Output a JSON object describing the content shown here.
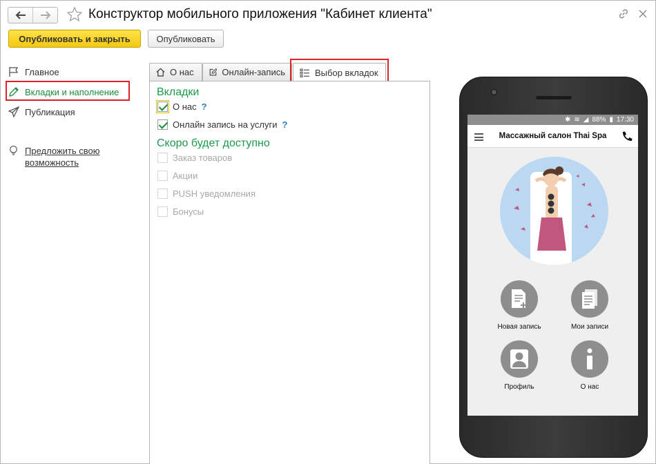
{
  "window": {
    "title": "Конструктор мобильного приложения \"Кабинет клиента\""
  },
  "toolbar": {
    "publish_close_label": "Опубликовать и закрыть",
    "publish_label": "Опубликовать"
  },
  "sidebar": {
    "items": [
      {
        "label": "Главное",
        "icon": "flag-icon"
      },
      {
        "label": "Вкладки и наполнение",
        "icon": "pencil-icon",
        "active": true
      },
      {
        "label": "Публикация",
        "icon": "paper-plane-icon"
      }
    ],
    "suggest_label": "Предложить свою возможность"
  },
  "tabs": [
    {
      "label": "О нас",
      "icon": "home-icon"
    },
    {
      "label": "Онлайн-запись",
      "icon": "edit-icon"
    },
    {
      "label": "Выбор вкладок",
      "icon": "list-icon",
      "active": true
    }
  ],
  "content": {
    "tabs_section_title": "Вкладки",
    "tabs_options": [
      {
        "label": "О нас",
        "checked": true,
        "help": "?"
      },
      {
        "label": "Онлайн запись на услуги",
        "checked": true,
        "help": "?"
      }
    ],
    "soon_section_title": "Скоро будет доступно",
    "soon_options": [
      {
        "label": "Заказ товаров",
        "checked": false
      },
      {
        "label": "Акции",
        "checked": false
      },
      {
        "label": "PUSH уведомления",
        "checked": false
      },
      {
        "label": "Бонусы",
        "checked": false
      }
    ]
  },
  "phone": {
    "status_battery": "88%",
    "status_time": "17:30",
    "app_title": "Массажный салон Thai Spa",
    "tiles": [
      {
        "label": "Новая запись",
        "icon": "new-document-icon"
      },
      {
        "label": "Мои записи",
        "icon": "documents-icon"
      },
      {
        "label": "Профиль",
        "icon": "user-icon"
      },
      {
        "label": "О нас",
        "icon": "info-icon"
      }
    ]
  },
  "colors": {
    "accent_green": "#1a9a4a",
    "primary_button": "#f4c810",
    "highlight_red": "#d8232a",
    "help_blue": "#2a7fc4"
  }
}
